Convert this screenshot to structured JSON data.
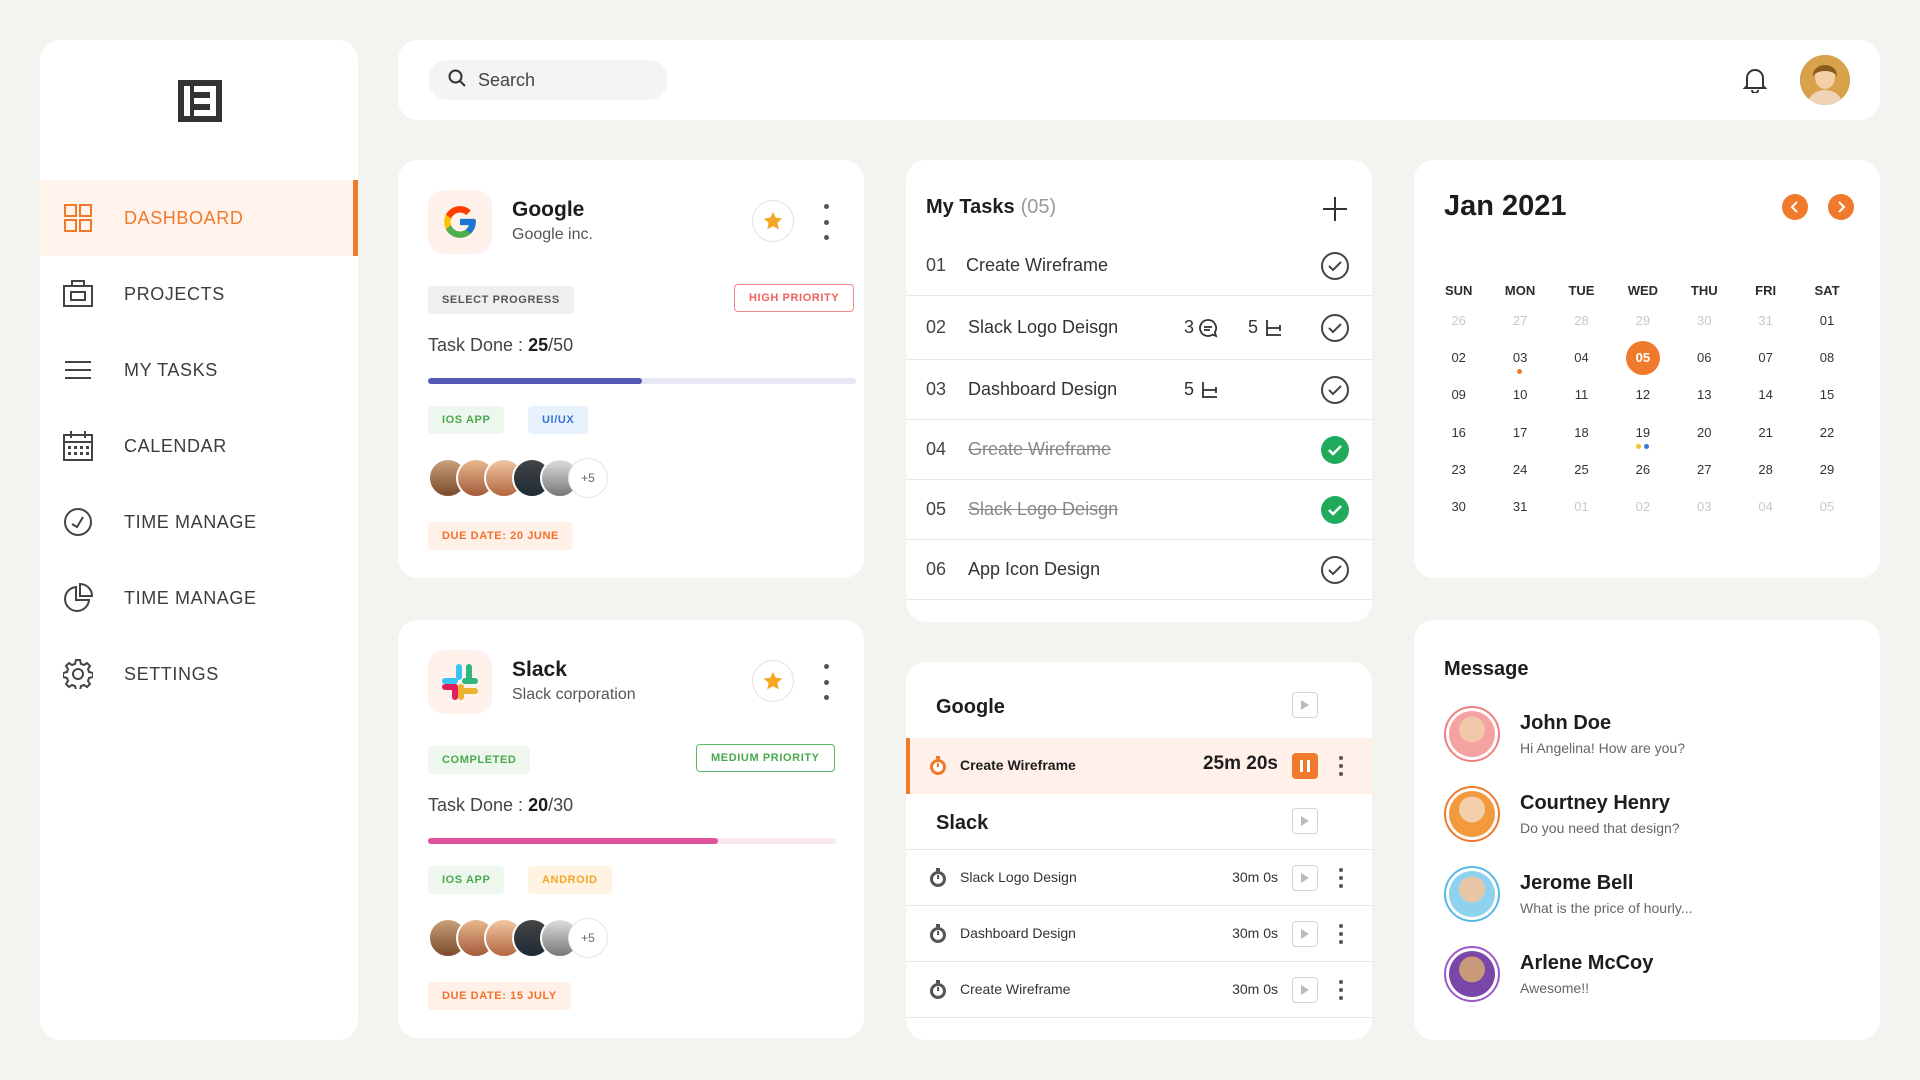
{
  "search": {
    "placeholder": "Search"
  },
  "sidebar": {
    "items": [
      {
        "label": "DASHBOARD",
        "icon": "grid-icon",
        "active": true
      },
      {
        "label": "PROJECTS",
        "icon": "briefcase-icon"
      },
      {
        "label": "MY TASKS",
        "icon": "menu-lines-icon"
      },
      {
        "label": "CALENDAR",
        "icon": "calendar-icon"
      },
      {
        "label": "TIME MANAGE",
        "icon": "clock-icon"
      },
      {
        "label": "TIME MANAGE",
        "icon": "pie-chart-icon"
      },
      {
        "label": "SETTINGS",
        "icon": "gear-icon"
      }
    ]
  },
  "projects": [
    {
      "name": "Google",
      "company": "Google inc.",
      "status": "SELECT PROGRESS",
      "priority": "HIGH PRIORITY",
      "task_done_label": "Task Done :",
      "done": "25",
      "total": "/50",
      "progress": 0.5,
      "tags": [
        "IOS APP",
        "UI/UX"
      ],
      "more": "+5",
      "due": "DUE DATE: 20 JUNE"
    },
    {
      "name": "Slack",
      "company": "Slack corporation",
      "status": "COMPLETED",
      "priority": "MEDIUM PRIORITY",
      "task_done_label": "Task Done :",
      "done": "20",
      "total": "/30",
      "progress": 0.71,
      "tags": [
        "IOS APP",
        "ANDROID"
      ],
      "more": "+5",
      "due": "DUE DATE: 15 JULY"
    }
  ],
  "my_tasks": {
    "title": "My Tasks",
    "count": "(05)",
    "items": [
      {
        "num": "01",
        "name": "Create Wireframe",
        "done": false
      },
      {
        "num": "02",
        "name": "Slack Logo Deisgn",
        "comments": "3",
        "subtasks": "5",
        "done": false
      },
      {
        "num": "03",
        "name": "Dashboard Design",
        "subtasks": "5",
        "done": false
      },
      {
        "num": "04",
        "name": "Greate Wireframe",
        "done": true
      },
      {
        "num": "05",
        "name": "Slack Logo Deisgn",
        "done": true
      },
      {
        "num": "06",
        "name": "App Icon Design",
        "done": false
      }
    ]
  },
  "timers": {
    "groups": [
      {
        "name": "Google",
        "items": [
          {
            "name": "Create Wireframe",
            "time": "25m 20s",
            "active": true
          }
        ]
      },
      {
        "name": "Slack",
        "items": [
          {
            "name": "Slack Logo Design",
            "time": "30m 0s"
          },
          {
            "name": "Dashboard Design",
            "time": "30m 0s"
          },
          {
            "name": "Create Wireframe",
            "time": "30m 0s"
          }
        ]
      }
    ]
  },
  "calendar": {
    "title": "Jan 2021",
    "days": [
      "SUN",
      "MON",
      "TUE",
      "WED",
      "THU",
      "FRI",
      "SAT"
    ],
    "weeks": [
      [
        "26",
        "27",
        "28",
        "29",
        "30",
        "31",
        "01"
      ],
      [
        "02",
        "03",
        "04",
        "05",
        "06",
        "07",
        "08"
      ],
      [
        "09",
        "10",
        "11",
        "12",
        "13",
        "14",
        "15"
      ],
      [
        "16",
        "17",
        "18",
        "19",
        "20",
        "21",
        "22"
      ],
      [
        "23",
        "24",
        "25",
        "26",
        "27",
        "28",
        "29"
      ],
      [
        "30",
        "31",
        "01",
        "02",
        "03",
        "04",
        "05"
      ]
    ],
    "today": "05",
    "accent": "#f07a2c"
  },
  "messages": {
    "title": "Message",
    "items": [
      {
        "name": "John Doe",
        "text": "Hi Angelina! How are you?",
        "ring": "#f08080"
      },
      {
        "name": "Courtney Henry",
        "text": "Do you need that design?",
        "ring": "#f07a2c"
      },
      {
        "name": "Jerome Bell",
        "text": "What is the price of hourly...",
        "ring": "#59b8e6"
      },
      {
        "name": "Arlene McCoy",
        "text": "Awesome!!",
        "ring": "#9b59c9"
      }
    ]
  }
}
